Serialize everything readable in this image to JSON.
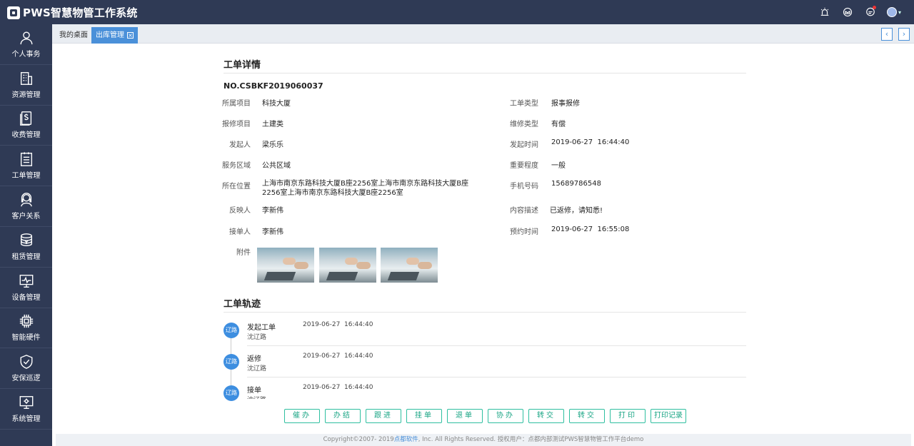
{
  "app": {
    "title": "PWS智慧物管工作系统"
  },
  "sidebar": {
    "items": [
      {
        "label": "个人事务",
        "icon": "person-icon"
      },
      {
        "label": "资源管理",
        "icon": "building-icon"
      },
      {
        "label": "收费管理",
        "icon": "money-icon"
      },
      {
        "label": "工单管理",
        "icon": "clipboard-icon"
      },
      {
        "label": "客户关系",
        "icon": "headset-icon"
      },
      {
        "label": "租赁管理",
        "icon": "coins-icon"
      },
      {
        "label": "设备管理",
        "icon": "monitor-icon"
      },
      {
        "label": "智能硬件",
        "icon": "chip-icon"
      },
      {
        "label": "安保巡逻",
        "icon": "shield-icon"
      },
      {
        "label": "系统管理",
        "icon": "settings-monitor-icon"
      }
    ]
  },
  "tabs": {
    "home": "我的桌面",
    "active": "出库管理"
  },
  "detail": {
    "title": "工单详情",
    "order_no": "NO.CSBKF2019060037",
    "left": {
      "project_label": "所属项目",
      "project": "科技大厦",
      "repair_item_label": "报修项目",
      "repair_item": "土建类",
      "initiator_label": "发起人",
      "initiator": "梁乐乐",
      "area_label": "服务区域",
      "area": "公共区域",
      "location_label": "所在位置",
      "location": "上海市南京东路科技大厦B座2256室上海市南京东路科技大厦B座2256室上海市南京东路科技大厦B座2256室",
      "reporter_label": "反映人",
      "reporter": "李新伟",
      "receiver_label": "接单人",
      "receiver": "李新伟",
      "attachment_label": "附件"
    },
    "right": {
      "type_label": "工单类型",
      "type": "报事报修",
      "repair_type_label": "维修类型",
      "repair_type": "有偿",
      "start_time_label": "发起时间",
      "start_time": "2019-06-27  16:44:40",
      "priority_label": "重要程度",
      "priority": "一般",
      "phone_label": "手机号码",
      "phone": "15689786548",
      "desc_label": "内容描述",
      "desc": "已返修，请知悉!",
      "appoint_label": "预约时间",
      "appoint_time": "2019-06-27  16:55:08"
    }
  },
  "track": {
    "title": "工单轨迹",
    "items": [
      {
        "avatar": "辽路",
        "action": "发起工单",
        "user": "沈辽路",
        "time": "2019-06-27  16:44:40"
      },
      {
        "avatar": "辽路",
        "action": "返修",
        "user": "沈辽路",
        "time": "2019-06-27  16:44:40"
      },
      {
        "avatar": "辽路",
        "action": "接单",
        "user": "沈辽路",
        "time": "2019-06-27  16:44:40"
      }
    ]
  },
  "buttons": [
    "催办",
    "办结",
    "跟进",
    "挂单",
    "退单",
    "协办",
    "转交",
    "转交",
    "打印",
    "打印记录"
  ],
  "footer": {
    "prefix": "Copyright©2007- 2019",
    "brand": "点都软件",
    "suffix": ", Inc. All Rights Reserved. 授权用户：点都内部测试PWS智慧物管工作平台demo"
  },
  "colors": {
    "nav_bg": "#2f3a55",
    "accent": "#4a90d9",
    "button_border": "#2fbfa0"
  }
}
